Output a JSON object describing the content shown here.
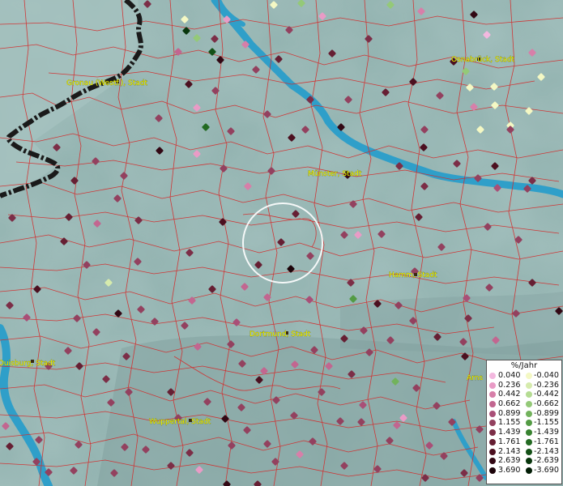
{
  "cities": [
    {
      "name": "Gronau (Westf.), Stadt",
      "icon": "city-marker"
    },
    {
      "name": "Osnabrück, Stadt",
      "icon": "city-marker"
    },
    {
      "name": "Münster, Stadt",
      "icon": "city-marker"
    },
    {
      "name": "Hamm, Stadt",
      "icon": "city-marker"
    },
    {
      "name": "Dortmund, Stadt",
      "icon": "city-marker"
    },
    {
      "name": "Duisburg, Stadt",
      "icon": "city-marker"
    },
    {
      "name": "Wuppertal, Stadt",
      "icon": "city-marker"
    },
    {
      "name": "Arns",
      "icon": "city-marker"
    }
  ],
  "legend": {
    "title": "%/Jahr",
    "positive": [
      {
        "value": "0.040",
        "color": "#f3b8df"
      },
      {
        "value": "0.236",
        "color": "#e99bc6"
      },
      {
        "value": "0.442",
        "color": "#d77fa9"
      },
      {
        "value": "0.662",
        "color": "#c26690"
      },
      {
        "value": "0.899",
        "color": "#a94f77"
      },
      {
        "value": "1.155",
        "color": "#93415f"
      },
      {
        "value": "1.439",
        "color": "#7c2e47"
      },
      {
        "value": "1.761",
        "color": "#661f33"
      },
      {
        "value": "2.143",
        "color": "#4c1020"
      },
      {
        "value": "2.639",
        "color": "#320814"
      },
      {
        "value": "3.690",
        "color": "#1c0309"
      }
    ],
    "negative": [
      {
        "value": "-0.040",
        "color": "#f4f8c4"
      },
      {
        "value": "-0.236",
        "color": "#d6ebad"
      },
      {
        "value": "-0.442",
        "color": "#b5dc93"
      },
      {
        "value": "-0.662",
        "color": "#94c978"
      },
      {
        "value": "-0.899",
        "color": "#72b25c"
      },
      {
        "value": "-1.155",
        "color": "#539b44"
      },
      {
        "value": "-1.439",
        "color": "#388330"
      },
      {
        "value": "-1.761",
        "color": "#236a22"
      },
      {
        "value": "-2.143",
        "color": "#135016"
      },
      {
        "value": "-2.639",
        "color": "#08360c"
      },
      {
        "value": "-3.690",
        "color": "#021d05"
      }
    ]
  },
  "colors": {
    "land": "#8fb0ad",
    "river": "#2f9fc9",
    "boundary": "#d42a2a",
    "border_line": "#1a1a1a",
    "highlight_ring": "#ffffff",
    "city_label": "#f2f200"
  }
}
